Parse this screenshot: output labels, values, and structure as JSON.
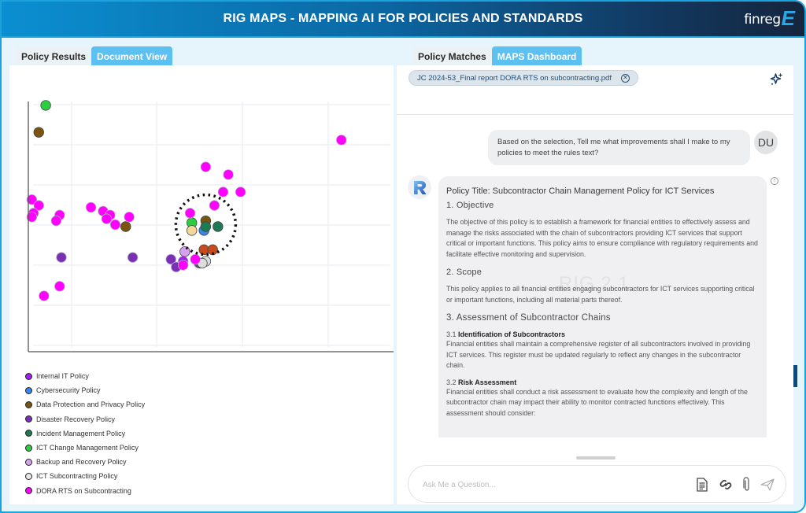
{
  "header": {
    "title": "RIG MAPS - MAPPING AI FOR POLICIES AND STANDARDS",
    "logo_text": "finreg",
    "logo_mark": "E"
  },
  "left_tabs": [
    {
      "label": "Policy Results",
      "active": false
    },
    {
      "label": "Document View",
      "active": true
    }
  ],
  "right_tabs": [
    {
      "label": "Policy Matches",
      "active": false
    },
    {
      "label": "MAPS Dashboard",
      "active": true
    }
  ],
  "chart_data": {
    "type": "scatter",
    "title": "",
    "xlabel": "",
    "ylabel": "",
    "grid": true,
    "legend_position": "bottom-left",
    "highlight": {
      "shape": "dotted-circle",
      "center": [
        10.2,
        6.6
      ],
      "radius_note": "encloses cluster"
    },
    "series": [
      {
        "name": "Internal IT Policy",
        "color": "#a020f0",
        "points": [
          [
            9.8,
            4.6
          ],
          [
            8.9,
            4.7
          ]
        ]
      },
      {
        "name": "Cybersecurity Policy",
        "color": "#3a86e8",
        "points": [
          [
            10.1,
            6.3
          ]
        ]
      },
      {
        "name": "Data Protection and Privacy Policy",
        "color": "#7a5410",
        "points": [
          [
            0.6,
            11.4
          ],
          [
            5.6,
            6.5
          ],
          [
            10.2,
            6.8
          ]
        ]
      },
      {
        "name": "Disaster Recovery Policy",
        "color": "#7b2fb5",
        "points": [
          [
            1.9,
            4.9
          ],
          [
            6.0,
            4.9
          ],
          [
            8.2,
            4.8
          ],
          [
            8.5,
            4.4
          ]
        ]
      },
      {
        "name": "Incident Management Policy",
        "color": "#1e7a52",
        "points": [
          [
            10.2,
            6.5
          ],
          [
            10.9,
            6.5
          ],
          [
            9.9,
            4.6
          ]
        ]
      },
      {
        "name": "ICT Change Management Policy",
        "color": "#2ecc40",
        "points": [
          [
            1.0,
            12.8
          ],
          [
            9.4,
            6.7
          ]
        ]
      },
      {
        "name": "Backup and Recovery Policy",
        "color": "#d8a0f0",
        "points": [
          [
            9.0,
            5.2
          ]
        ]
      },
      {
        "name": "ICT Subcontracting Policy",
        "color": "#dcdcdc",
        "points": [
          [
            10.2,
            4.7
          ],
          [
            10.0,
            4.6
          ]
        ]
      },
      {
        "name": "DORA RTS on Subcontracting",
        "color": "#ff00ff",
        "points": [
          [
            0.2,
            7.9
          ],
          [
            0.6,
            7.6
          ],
          [
            0.3,
            7.2
          ],
          [
            0.2,
            7.0
          ],
          [
            1.8,
            7.1
          ],
          [
            1.6,
            6.8
          ],
          [
            3.6,
            7.5
          ],
          [
            4.3,
            7.3
          ],
          [
            4.7,
            7.1
          ],
          [
            4.5,
            6.9
          ],
          [
            5.0,
            6.6
          ],
          [
            5.8,
            7.0
          ],
          [
            9.3,
            7.2
          ],
          [
            10.7,
            7.6
          ],
          [
            11.2,
            8.3
          ],
          [
            12.2,
            8.3
          ],
          [
            11.5,
            9.2
          ],
          [
            10.2,
            9.6
          ],
          [
            18.0,
            11.0
          ],
          [
            0.9,
            2.9
          ],
          [
            1.8,
            3.4
          ],
          [
            8.9,
            4.5
          ],
          [
            9.6,
            4.8
          ]
        ]
      },
      {
        "name": "Cluster (other)",
        "color": "#c84a1a",
        "legend": false,
        "points": [
          [
            10.1,
            5.3
          ],
          [
            10.6,
            5.3
          ]
        ]
      },
      {
        "name": "Cluster (highlight)",
        "color": "#f5d99a",
        "legend": false,
        "points": [
          [
            9.4,
            6.3
          ]
        ]
      }
    ],
    "xlim": [
      0,
      21
    ],
    "ylim": [
      0,
      13
    ]
  },
  "legend": [
    {
      "label": "Internal IT Policy",
      "color": "#a020f0"
    },
    {
      "label": "Cybersecurity Policy",
      "color": "#3a86e8"
    },
    {
      "label": "Data Protection and Privacy Policy",
      "color": "#7a5410"
    },
    {
      "label": "Disaster Recovery Policy",
      "color": "#7b2fb5"
    },
    {
      "label": "Incident Management Policy",
      "color": "#1e7a52"
    },
    {
      "label": "ICT Change Management Policy",
      "color": "#2ecc40"
    },
    {
      "label": "Backup and Recovery Policy",
      "color": "#d8a0f0"
    },
    {
      "label": "ICT Subcontracting Policy",
      "color": "#e8e8e8"
    },
    {
      "label": "DORA RTS on Subcontracting",
      "color": "#ff00ff"
    }
  ],
  "chat": {
    "file_chip": "JC 2024-53_Final report DORA RTS on subcontracting.pdf",
    "close_icon": "x-circle-icon",
    "sparkle_icon": "sparkle-icon",
    "user_initials": "DU",
    "user_message": "Based on the selection, Tell me what improvements shall I make to my policies to meet the rules text?",
    "watermark": "RIG 2.1",
    "response": {
      "policy_title": "Policy Title: Subcontractor Chain Management Policy for ICT Services",
      "s1_heading": "1. Objective",
      "s1_text": "The objective of this policy is to establish a framework for financial entities to effectively assess and manage the risks associated with the chain of subcontractors providing ICT services that support critical or important functions. This policy aims to ensure compliance with regulatory requirements and facilitate effective monitoring and supervision.",
      "s2_heading": "2. Scope",
      "s2_text": "This policy applies to all financial entities engaging subcontractors for ICT services supporting critical or important functions, including all material parts thereof.",
      "s3_heading": "3. Assessment of Subcontractor Chains",
      "s31_num": "3.1",
      "s31_title": "Identification of Subcontractors",
      "s31_text": "Financial entities shall maintain a comprehensive register of all subcontractors involved in providing ICT services. This register must be updated regularly to reflect any changes in the subcontractor chain.",
      "s32_num": "3.2",
      "s32_title": "Risk Assessment",
      "s32_text": "Financial entities shall conduct a risk assessment to evaluate how the complexity and length of the subcontractor chain may impact their ability to monitor contracted functions effectively. This assessment should consider:"
    },
    "input_placeholder": "Ask Me a Question...",
    "input_value": ""
  }
}
